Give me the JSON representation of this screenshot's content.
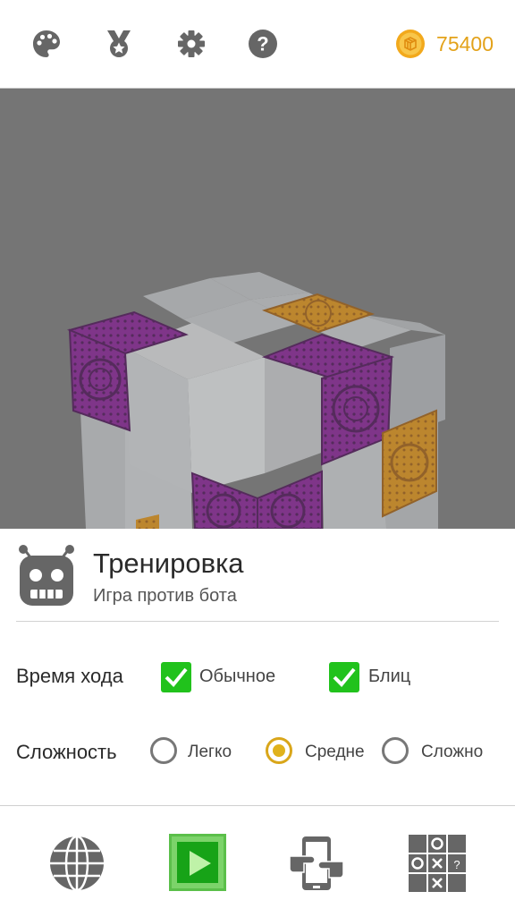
{
  "toolbar": {
    "icons": [
      "palette-icon",
      "medal-icon",
      "gear-icon",
      "help-icon"
    ],
    "coin_icon": "coin-icon",
    "coins": "75400"
  },
  "scene": {
    "description_icons": "cube-board"
  },
  "mode": {
    "icon": "robot-icon",
    "title": "Тренировка",
    "subtitle": "Игра против бота"
  },
  "move_time": {
    "label": "Время хода",
    "options": [
      {
        "label": "Обычное",
        "checked": true
      },
      {
        "label": "Блиц",
        "checked": true
      }
    ]
  },
  "difficulty": {
    "label": "Сложность",
    "options": [
      {
        "label": "Легко",
        "selected": false
      },
      {
        "label": "Средне",
        "selected": true
      },
      {
        "label": "Сложно",
        "selected": false
      }
    ]
  },
  "bottom_nav": {
    "icons": [
      "globe-icon",
      "play-icon",
      "phone-hands-icon",
      "tic-tac-toe-icon"
    ]
  },
  "colors": {
    "accent_green": "#21c21c",
    "coin_gold": "#e3a21a",
    "radio_selected": "#e0b21c",
    "cube_purple": "#8a1a9a",
    "cube_orange": "#e8950f"
  }
}
